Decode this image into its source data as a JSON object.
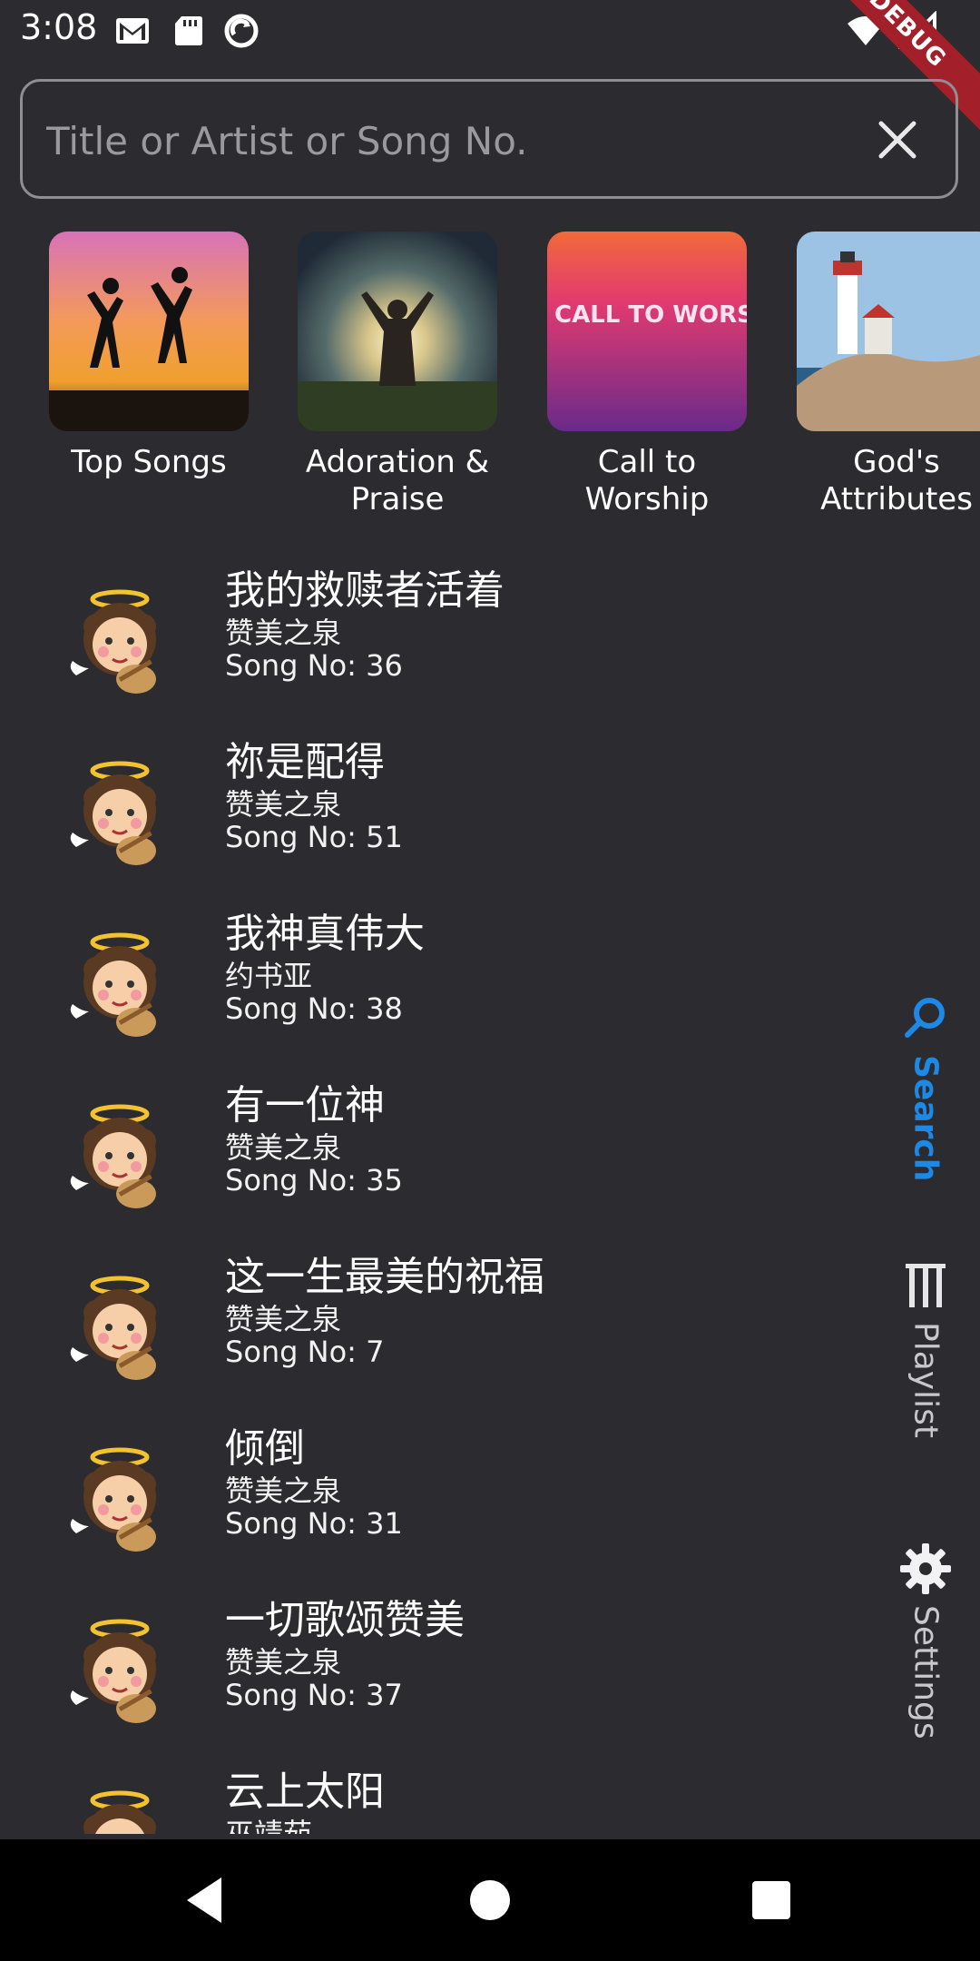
{
  "status_bar": {
    "time": "3:08"
  },
  "debug_banner": "DEBUG",
  "search": {
    "placeholder": "Title or Artist or Song No.",
    "value": ""
  },
  "categories": [
    {
      "label": "Top Songs"
    },
    {
      "label": "Adoration & Praise"
    },
    {
      "label": "Call to Worship",
      "art_text": "THE CALL TO WORSHIP"
    },
    {
      "label": "God's Attributes"
    }
  ],
  "songs": [
    {
      "title": "我的救赎者活着",
      "artist": "赞美之泉",
      "song_no": "Song No: 36"
    },
    {
      "title": "祢是配得",
      "artist": "赞美之泉",
      "song_no": "Song No: 51"
    },
    {
      "title": "我神真伟大",
      "artist": "约书亚",
      "song_no": "Song No: 38"
    },
    {
      "title": "有一位神",
      "artist": "赞美之泉",
      "song_no": "Song No: 35"
    },
    {
      "title": "这一生最美的祝福",
      "artist": "赞美之泉",
      "song_no": "Song No: 7"
    },
    {
      "title": "倾倒",
      "artist": "赞美之泉",
      "song_no": "Song No: 31"
    },
    {
      "title": "一切歌颂赞美",
      "artist": "赞美之泉",
      "song_no": "Song No: 37"
    },
    {
      "title": "云上太阳",
      "artist": "巫靖茹",
      "song_no": ""
    }
  ],
  "nav_rail": {
    "items": [
      {
        "label": "Search",
        "icon": "search-icon",
        "active": true
      },
      {
        "label": "Playlist",
        "icon": "playlist-icon",
        "active": false
      },
      {
        "label": "Settings",
        "icon": "gear-icon",
        "active": false
      }
    ],
    "active_color": "#1e88e5",
    "inactive_color": "#c8c8cc"
  }
}
